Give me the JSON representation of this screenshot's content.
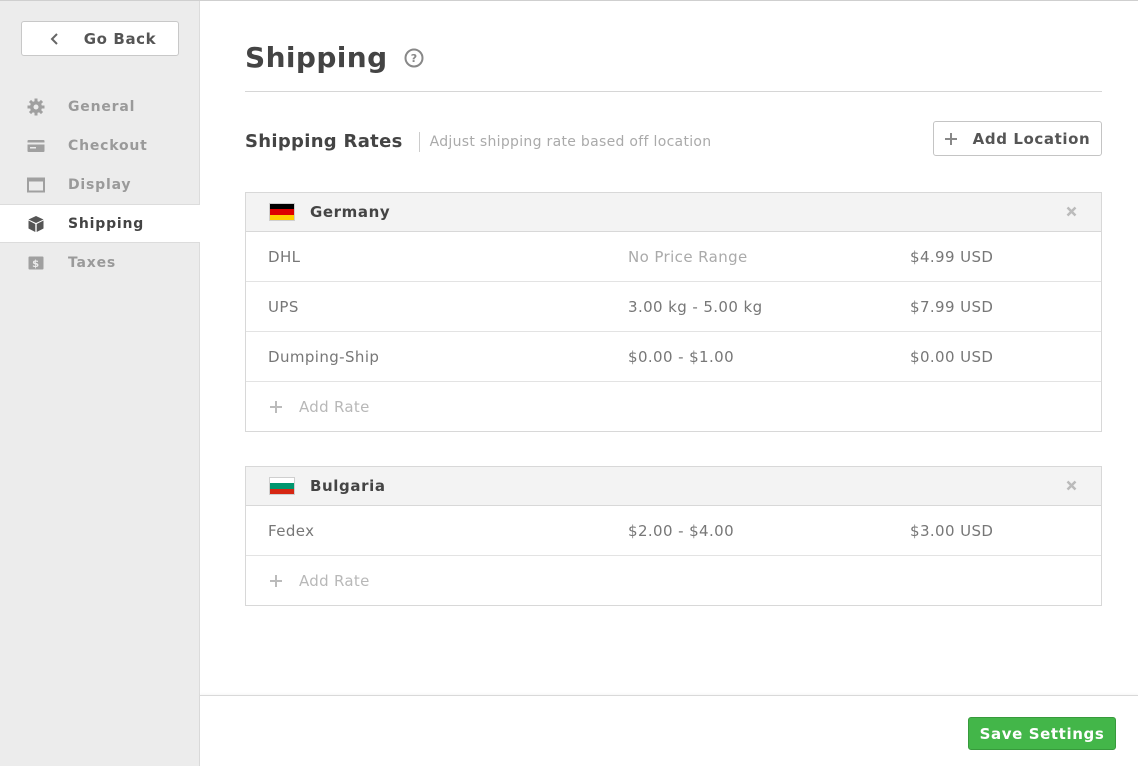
{
  "sidebar": {
    "go_back_label": "Go Back",
    "items": [
      {
        "label": "General",
        "icon": "gear-icon"
      },
      {
        "label": "Checkout",
        "icon": "card-icon"
      },
      {
        "label": "Display",
        "icon": "window-icon"
      },
      {
        "label": "Shipping",
        "icon": "box-icon",
        "active": true
      },
      {
        "label": "Taxes",
        "icon": "dollar-icon"
      }
    ]
  },
  "main": {
    "title": "Shipping",
    "help_icon": "question-circle-icon",
    "rates_title": "Shipping Rates",
    "rates_subtitle": "Adjust shipping rate based off location",
    "add_location_label": "Add Location",
    "add_rate_label": "Add Rate",
    "locations": [
      {
        "name": "Germany",
        "flag_colors": [
          "#000000",
          "#dd0000",
          "#ffce00"
        ],
        "rates": [
          {
            "carrier": "DHL",
            "range": "No Price Range",
            "price": "$4.99 USD"
          },
          {
            "carrier": "UPS",
            "range": "3.00 kg - 5.00 kg",
            "price": "$7.99 USD"
          },
          {
            "carrier": "Dumping-Ship",
            "range": "$0.00 - $1.00",
            "price": "$0.00 USD"
          }
        ]
      },
      {
        "name": "Bulgaria",
        "flag_colors": [
          "#ffffff",
          "#00966e",
          "#d62612"
        ],
        "rates": [
          {
            "carrier": "Fedex",
            "range": "$2.00 - $4.00",
            "price": "$3.00 USD"
          }
        ]
      }
    ]
  },
  "footer": {
    "save_label": "Save Settings"
  },
  "colors": {
    "accent_green": "#43b649",
    "sidebar_bg": "#ececec"
  }
}
